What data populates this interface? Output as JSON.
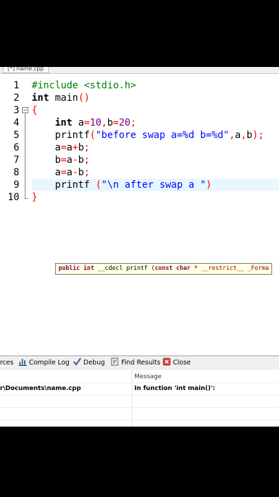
{
  "tab": {
    "label": "[*] name.cpp"
  },
  "editor": {
    "line_numbers": [
      "1",
      "2",
      "3",
      "4",
      "5",
      "6",
      "7",
      "8",
      "9",
      "10"
    ],
    "active_line": 9
  },
  "tooltip": {
    "text_parts": [
      "public int",
      " __cdecl printf (",
      "const char",
      " * ",
      "__restrict__",
      " _Forma"
    ]
  },
  "panel": {
    "tabs": [
      {
        "label": "rces"
      },
      {
        "label": "Compile Log"
      },
      {
        "label": "Debug"
      },
      {
        "label": "Find Results"
      },
      {
        "label": "Close"
      }
    ]
  },
  "output": {
    "columns": [
      "",
      "Message"
    ],
    "rows": [
      {
        "file": "r\\Documents\\name.cpp",
        "message": "In function 'int main()':"
      }
    ]
  },
  "colors": {
    "keyword": "#000000",
    "preprocessor": "#008000",
    "number": "#800080",
    "string": "#0000ff",
    "operator": "#ff0000",
    "active_line_bg": "#e8f7ff",
    "tooltip_bg": "#ffffe1"
  }
}
